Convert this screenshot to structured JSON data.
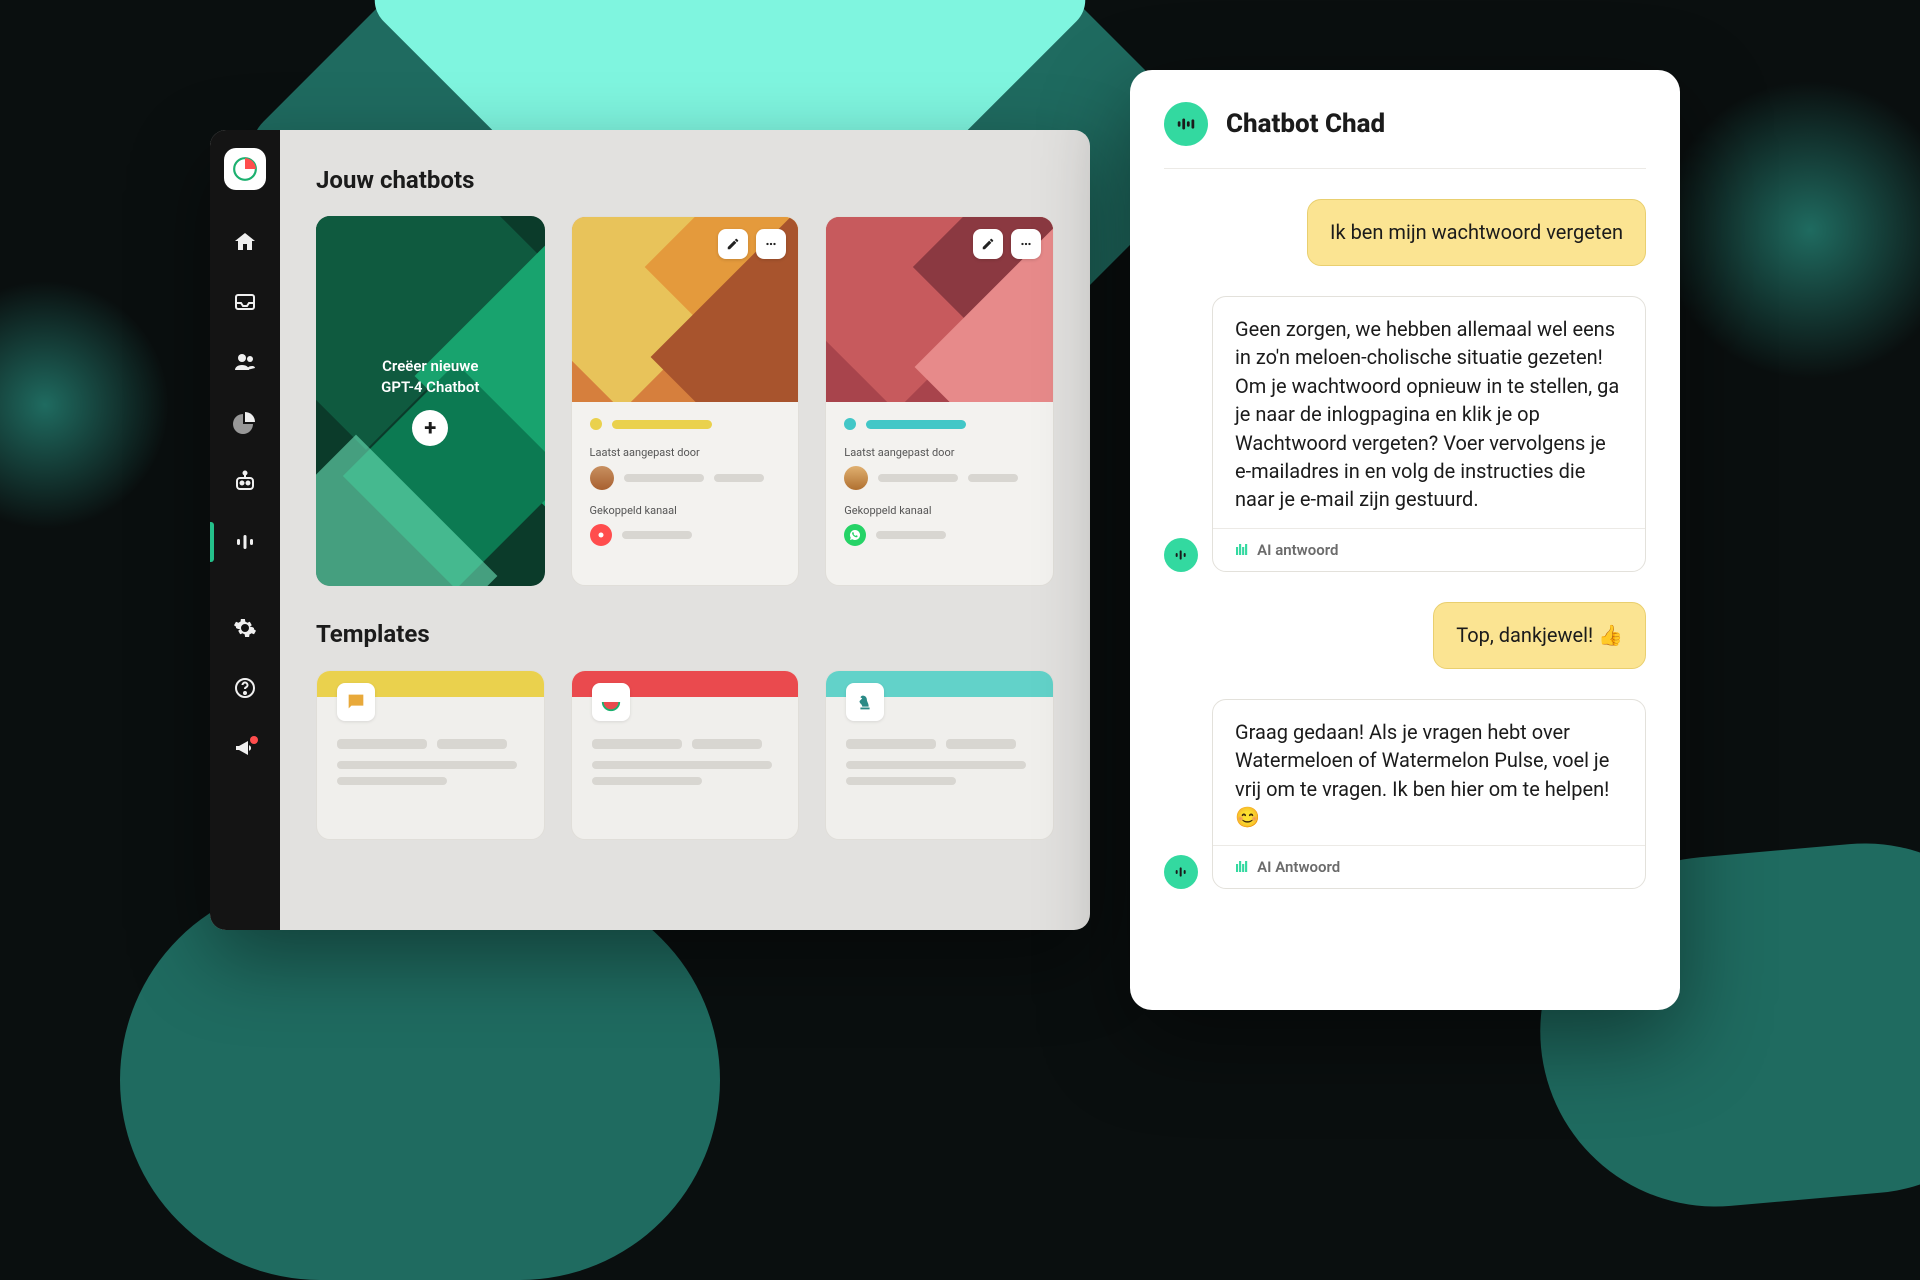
{
  "colors": {
    "accent": "#33d9a0",
    "yellow": "#ead14d",
    "teal": "#42c7c7",
    "red": "#ea4a4e"
  },
  "sidebar": {
    "items": [
      {
        "name": "home"
      },
      {
        "name": "inbox"
      },
      {
        "name": "contacts"
      },
      {
        "name": "analytics"
      },
      {
        "name": "bot"
      },
      {
        "name": "pulse",
        "active": true
      },
      {
        "name": "settings"
      },
      {
        "name": "help"
      },
      {
        "name": "announcements",
        "badge": true
      }
    ]
  },
  "main": {
    "section1_title": "Jouw chatbots",
    "create_card": {
      "line1": "Creëer nieuwe",
      "line2": "GPT-4 Chatbot"
    },
    "bots": [
      {
        "status_color": "#ead14d",
        "edited_label": "Laatst aangepast door",
        "channel_label": "Gekoppeld kanaal",
        "channel_color": "#ff4d4d"
      },
      {
        "status_color": "#42c7c7",
        "edited_label": "Laatst aangepast door",
        "channel_label": "Gekoppeld kanaal",
        "channel_color": "#25D366"
      }
    ],
    "section2_title": "Templates",
    "templates": [
      {
        "stripe": "#ead14d",
        "icon": "chat",
        "iconColor": "#e8a93a"
      },
      {
        "stripe": "#ea4a4e",
        "icon": "watermelon",
        "iconColor": "#ea4a4e"
      },
      {
        "stripe": "#62d2c9",
        "icon": "knight",
        "iconColor": "#2a8a86"
      }
    ]
  },
  "chat": {
    "title": "Chatbot Chad",
    "messages": [
      {
        "role": "user",
        "text": "Ik ben mijn wachtwoord vergeten"
      },
      {
        "role": "bot",
        "text": "Geen zorgen, we hebben allemaal wel eens in zo'n meloen-cholische situatie gezeten! Om je wachtwoord opnieuw in te stellen, ga je naar de inlogpagina en klik je op Wachtwoord vergeten? Voer vervolgens je e-mailadres in en volg de instructies die naar je e-mail zijn gestuurd.",
        "footer": "AI antwoord"
      },
      {
        "role": "user",
        "text": "Top, dankjewel! 👍"
      },
      {
        "role": "bot",
        "text": "Graag gedaan! Als je vragen hebt over Watermeloen of Watermelon Pulse, voel je vrij om te vragen. Ik ben hier om te helpen! 😊",
        "footer": "AI Antwoord"
      }
    ]
  }
}
